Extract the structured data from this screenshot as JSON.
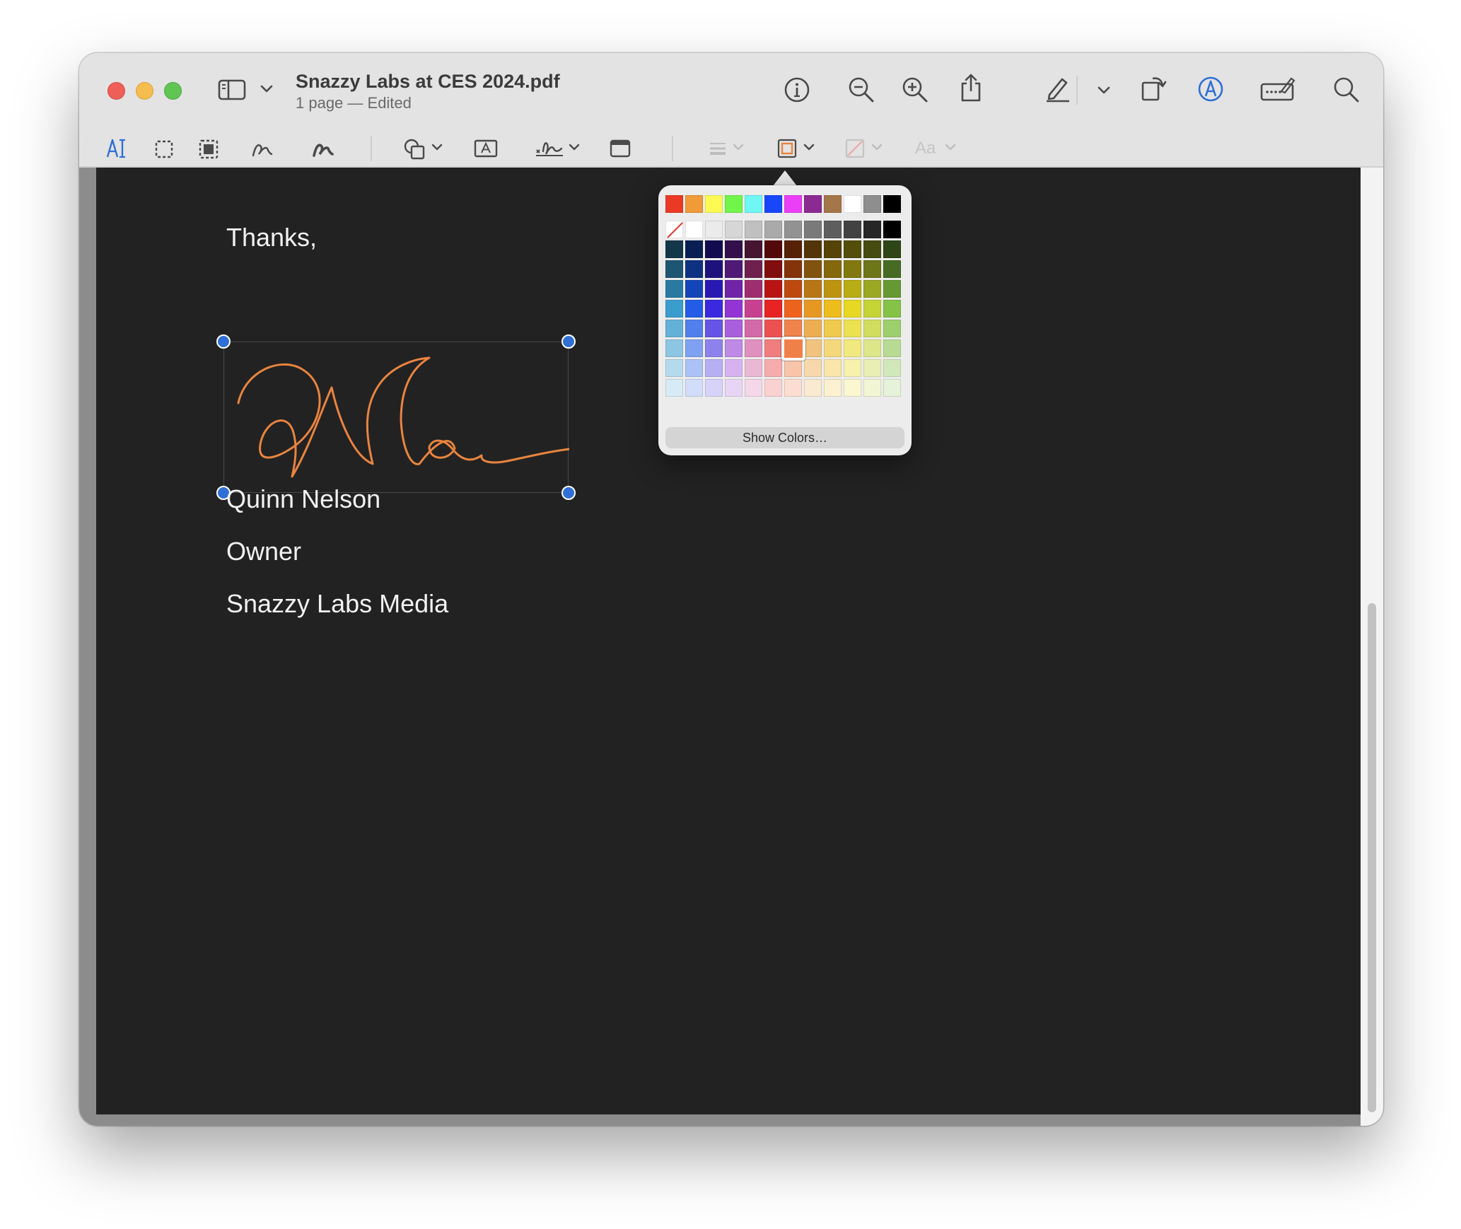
{
  "window": {
    "title": "Snazzy Labs at CES 2024.pdf",
    "subtitle": "1 page — Edited"
  },
  "markup_toolbar": {
    "font_label": "Aa"
  },
  "page": {
    "lines": [
      "Thanks,",
      "Quinn Nelson",
      "Owner",
      "Snazzy Labs Media"
    ]
  },
  "signature": {
    "stroke_color": "#e98440"
  },
  "color_picker": {
    "show_colors_label": "Show Colors…",
    "selected_color": "#f0804a",
    "top_row": [
      "#ea3a25",
      "#f19a38",
      "#fdfb53",
      "#72f54a",
      "#6ef7f5",
      "#1746fb",
      "#ea3ff6",
      "#8b2a91",
      "#a4774a",
      "#ffffff",
      "#8e8e8e",
      "#000000"
    ]
  },
  "colors": {
    "accent": "#2f6fd6",
    "page_background": "#222222",
    "text": "#f2f2f2"
  }
}
